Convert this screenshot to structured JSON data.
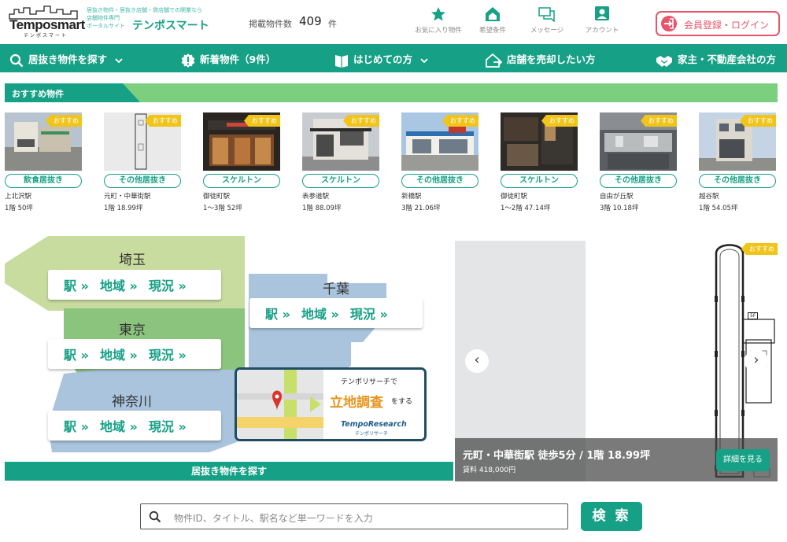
{
  "header": {
    "logo_text": "Temposmart",
    "logo_sub": "テンポスマート",
    "tagline_1": "居抜き物件・居抜き店舗・貸店舗での開業なら",
    "tagline_2": "店舗物件専門",
    "tagline_3": "ポータルサイト",
    "brand": "テンポスマート",
    "count_label": "掲載物件数",
    "count": "409",
    "count_unit": "件",
    "nav": [
      {
        "label": "お気に入り物件",
        "icon": "star-icon"
      },
      {
        "label": "希望条件",
        "icon": "house-icon"
      },
      {
        "label": "メッセージ",
        "icon": "chat-icon"
      },
      {
        "label": "アカウント",
        "icon": "account-icon"
      }
    ],
    "login": "会員登録・ログイン"
  },
  "main_nav": [
    {
      "label": "居抜き物件を探す",
      "icon": "search-icon"
    },
    {
      "label": "新着物件（9件）",
      "icon": "alert-icon"
    },
    {
      "label": "はじめての方",
      "icon": "book-icon"
    },
    {
      "label": "店舗を売却したい方",
      "icon": "house-arrow-icon"
    },
    {
      "label": "家主・不動産会社の方",
      "icon": "handshake-icon"
    }
  ],
  "recommended": {
    "title": "おすすめ物件",
    "badge": "おすすめ",
    "items": [
      {
        "category": "飲食居抜き",
        "station": "上北沢駅",
        "floor": "1階 50坪"
      },
      {
        "category": "その他居抜き",
        "station": "元町・中華街駅",
        "floor": "1階 18.99坪"
      },
      {
        "category": "スケルトン",
        "station": "御徒町駅",
        "floor": "1～3階 52坪"
      },
      {
        "category": "スケルトン",
        "station": "表参道駅",
        "floor": "1階 88.09坪"
      },
      {
        "category": "その他居抜き",
        "station": "新橋駅",
        "floor": "3階 21.06坪"
      },
      {
        "category": "スケルトン",
        "station": "御徒町駅",
        "floor": "1～2階 47.14坪"
      },
      {
        "category": "その他居抜き",
        "station": "自由が丘駅",
        "floor": "3階 10.18坪"
      },
      {
        "category": "その他居抜き",
        "station": "越谷駅",
        "floor": "1階 54.05坪"
      }
    ]
  },
  "map": {
    "regions": [
      "埼玉",
      "千葉",
      "東京",
      "神奈川"
    ],
    "links": [
      "駅",
      "地域",
      "現況"
    ],
    "arrow": "»",
    "search_band": "居抜き物件を探す",
    "tempo": {
      "line1": "テンポリサーチで",
      "line2": "立地調査",
      "line3": "をする",
      "logo": "TempoResearch",
      "logo_sub": "テンポリサーチ"
    }
  },
  "slider": {
    "badge": "おすすめ",
    "floor_label": "5F",
    "title": "元町・中華街駅 徒歩5分 / 1階 18.99坪",
    "rent": "賃料 418,000円",
    "detail": "詳細を見る",
    "prev": "‹",
    "next": "›"
  },
  "search": {
    "placeholder": "物件ID、タイトル、駅名など単一ワードを入力",
    "button": "検 索"
  }
}
